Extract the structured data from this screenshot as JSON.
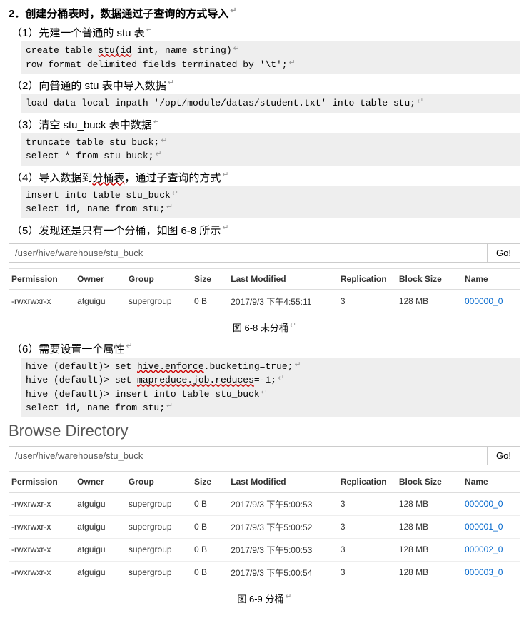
{
  "heading": "2．创建分桶表时，数据通过子查询的方式导入",
  "steps": {
    "s1": "（1）先建一个普通的 stu 表",
    "code1_a": "create table ",
    "code1_a_w": "stu(id",
    "code1_a2": " int, name string)",
    "code1_b": "row format delimited fields terminated by '\\t';",
    "s2": "（2）向普通的 stu 表中导入数据",
    "code2": "load data local inpath '/opt/module/datas/student.txt' into table stu;",
    "s3": "（3）清空 stu_buck 表中数据",
    "code3_a": "truncate table stu_buck;",
    "code3_b": "select * from stu buck;",
    "s4": "（4）导入数据到",
    "s4_w": "分桶表",
    "s4_b": "，通过子查询的方式",
    "code4_a": "insert into table stu_buck",
    "code4_b": "select id, name from stu;",
    "s5": "（5）发现还是只有一个分桶，如图 6-8 所示",
    "s6": "（6）需要设置一个属性",
    "code6_a_pre": "hive (default)> set ",
    "code6_a_w": "hive.enforce",
    "code6_a_post": ".bucketing=true;",
    "code6_b_pre": "hive (default)> set ",
    "code6_b_w": "mapreduce.job.reduces",
    "code6_b_post": "=-1;",
    "code6_c": "hive (default)> insert into table stu_buck",
    "code6_d": "select id, name from stu;"
  },
  "path": "/user/hive/warehouse/stu_buck",
  "go": "Go!",
  "cols": {
    "perm": "Permission",
    "owner": "Owner",
    "group": "Group",
    "size": "Size",
    "mod": "Last Modified",
    "rep": "Replication",
    "bs": "Block Size",
    "name": "Name"
  },
  "table1": [
    {
      "perm": "-rwxrwxr-x",
      "owner": "atguigu",
      "group": "supergroup",
      "size": "0 B",
      "mod": "2017/9/3 下午4:55:11",
      "rep": "3",
      "bs": "128 MB",
      "name": "000000_0"
    }
  ],
  "caption1": "图 6-8  未分桶",
  "browse": "Browse Directory",
  "table2": [
    {
      "perm": "-rwxrwxr-x",
      "owner": "atguigu",
      "group": "supergroup",
      "size": "0 B",
      "mod": "2017/9/3 下午5:00:53",
      "rep": "3",
      "bs": "128 MB",
      "name": "000000_0"
    },
    {
      "perm": "-rwxrwxr-x",
      "owner": "atguigu",
      "group": "supergroup",
      "size": "0 B",
      "mod": "2017/9/3 下午5:00:52",
      "rep": "3",
      "bs": "128 MB",
      "name": "000001_0"
    },
    {
      "perm": "-rwxrwxr-x",
      "owner": "atguigu",
      "group": "supergroup",
      "size": "0 B",
      "mod": "2017/9/3 下午5:00:53",
      "rep": "3",
      "bs": "128 MB",
      "name": "000002_0"
    },
    {
      "perm": "-rwxrwxr-x",
      "owner": "atguigu",
      "group": "supergroup",
      "size": "0 B",
      "mod": "2017/9/3 下午5:00:54",
      "rep": "3",
      "bs": "128 MB",
      "name": "000003_0"
    }
  ],
  "caption2": "图 6-9  分桶",
  "lf": "↵"
}
